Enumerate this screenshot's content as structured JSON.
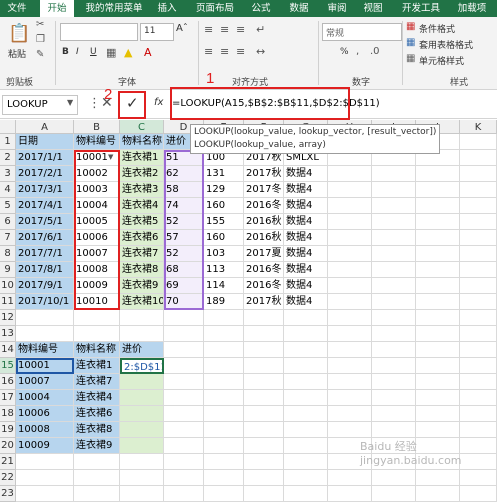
{
  "ribbon_tabs": [
    "文件",
    "开始",
    "我的常用菜单",
    "插入",
    "页面布局",
    "公式",
    "数据",
    "审阅",
    "视图",
    "开发工具",
    "加载项"
  ],
  "ribbon": {
    "paste": "粘贴",
    "clipboard": "剪贴板",
    "font": "字体",
    "alignment": "对齐方式",
    "number": "数字",
    "styles": "样式",
    "font_size": "11",
    "number_format": "常规",
    "cond_format": "条件格式",
    "table_format": "套用表格格式",
    "cell_style": "单元格样式",
    "bold": "B",
    "italic": "I",
    "underline": "U",
    "percent": "%"
  },
  "formula_bar": {
    "name_box": "LOOKUP",
    "fx": "fx",
    "formula": "=LOOKUP(A15,$B$2:$B$11,$D$2:$D$11)",
    "tooltip_line1": "LOOKUP(lookup_value, lookup_vector, [result_vector])",
    "tooltip_line2": "LOOKUP(lookup_value, array)"
  },
  "annotations": {
    "num1": "1",
    "num2": "2"
  },
  "columns": [
    "A",
    "B",
    "C",
    "D",
    "E",
    "F",
    "G",
    "H",
    "I",
    "J",
    "K"
  ],
  "rows": [
    "1",
    "2",
    "3",
    "4",
    "5",
    "6",
    "7",
    "8",
    "9",
    "10",
    "11",
    "12",
    "13",
    "14",
    "15",
    "16",
    "17",
    "18",
    "19",
    "20",
    "21",
    "22",
    "23"
  ],
  "table1": {
    "headers": [
      "日期",
      "物料编号",
      "物料名称",
      "进价"
    ],
    "rows": [
      [
        "2017/1/1",
        "10001",
        "连衣裙1",
        "51",
        "100",
        "2017秋",
        "SMLXL"
      ],
      [
        "2017/2/1",
        "10002",
        "连衣裙2",
        "62",
        "131",
        "2017秋",
        "数据4"
      ],
      [
        "2017/3/1",
        "10003",
        "连衣裙3",
        "58",
        "129",
        "2017冬",
        "数据4"
      ],
      [
        "2017/4/1",
        "10004",
        "连衣裙4",
        "74",
        "160",
        "2016冬",
        "数据4"
      ],
      [
        "2017/5/1",
        "10005",
        "连衣裙5",
        "52",
        "155",
        "2016秋",
        "数据4"
      ],
      [
        "2017/6/1",
        "10006",
        "连衣裙6",
        "57",
        "160",
        "2016秋",
        "数据4"
      ],
      [
        "2017/7/1",
        "10007",
        "连衣裙7",
        "52",
        "103",
        "2017夏",
        "数据4"
      ],
      [
        "2017/8/1",
        "10008",
        "连衣裙8",
        "68",
        "113",
        "2016冬",
        "数据4"
      ],
      [
        "2017/9/1",
        "10009",
        "连衣裙9",
        "69",
        "114",
        "2016冬",
        "数据4"
      ],
      [
        "2017/10/1",
        "10010",
        "连衣裙10",
        "70",
        "189",
        "2017秋",
        "数据4"
      ]
    ]
  },
  "table2": {
    "headers": [
      "物料编号",
      "物料名称",
      "进价"
    ],
    "rows": [
      [
        "10001",
        "连衣裙1",
        "2:$D$11)"
      ],
      [
        "10007",
        "连衣裙7",
        ""
      ],
      [
        "10004",
        "连衣裙4",
        ""
      ],
      [
        "10006",
        "连衣裙6",
        ""
      ],
      [
        "10008",
        "连衣裙8",
        ""
      ],
      [
        "10009",
        "连衣裙9",
        ""
      ]
    ]
  },
  "watermark": "Baidu 经验 jingyan.baidu.com"
}
